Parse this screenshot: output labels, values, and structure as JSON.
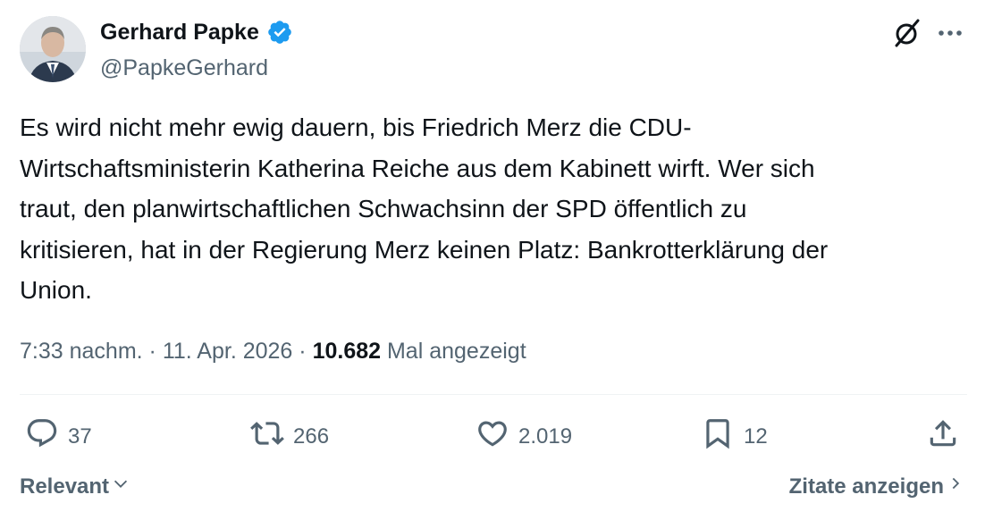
{
  "author": {
    "name": "Gerhard Papke",
    "handle": "@PapkeGerhard"
  },
  "tweet": {
    "text": "Es wird nicht mehr ewig dauern, bis Friedrich Merz die CDU-\nWirtschaftsministerin Katherina Reiche aus dem Kabinett wirft. Wer sich\ntraut, den planwirtschaftlichen Schwachsinn der SPD öffentlich zu\nkritisieren, hat in der Regierung Merz keinen Platz: Bankrotterklärung der\nUnion.",
    "time": "7:33 nachm.",
    "separator": "·",
    "date": "11. Apr. 2026",
    "views_count": "10.682",
    "views_label": "Mal angezeigt"
  },
  "actions": {
    "replies": "37",
    "reposts": "266",
    "likes": "2.019",
    "bookmarks": "12"
  },
  "footer": {
    "sort_label": "Relevant",
    "quotes_label": "Zitate anzeigen"
  },
  "colors": {
    "verified": "#1d9bf0",
    "text": "#0f1419",
    "secondary": "#536471"
  },
  "icons": [
    "verified-badge-icon",
    "grok-icon",
    "more-icon",
    "reply-icon",
    "repost-icon",
    "like-icon",
    "bookmark-icon",
    "share-icon",
    "chevron-down-icon",
    "chevron-right-icon"
  ]
}
